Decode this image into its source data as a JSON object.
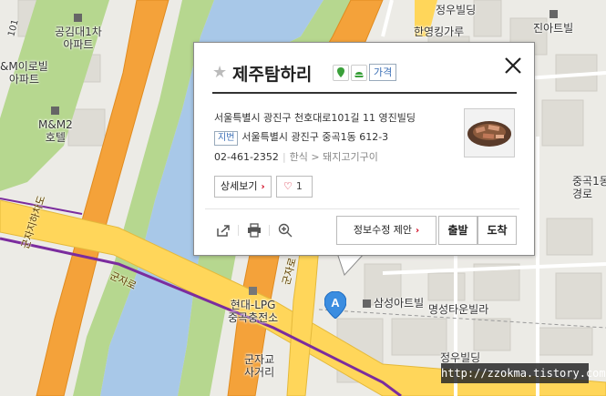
{
  "map": {
    "labels": {
      "gongpyeong": "공김대1차\n아파트",
      "mirae": "&M이로빌\n아파트",
      "mm2": "M&M2\n호텔",
      "jeongwoo_top": "정우빌딩",
      "jinatower": "진아트빌",
      "hanyeong": "한영킹가루",
      "junggok_right": "중곡1동\n경로",
      "samsung": "삼성아트빌",
      "myeongseong": "명성타운빌라",
      "hyundai": "현대-LPG\n중곡충전소",
      "gunja": "군자교\n사거리",
      "jeongwoo_bottom": "정우빌딩",
      "num101": "101"
    },
    "roads": {
      "gunjaro_1": "군자로",
      "gunjaro_2": "군자로",
      "jihadong": "군자지하차도",
      "gunjaro_bottom": "군자로"
    }
  },
  "popup": {
    "name": "제주탐하리",
    "price_badge": "가격",
    "address": "서울특별시 광진구 천호대로101길 11 영진빌딩",
    "jibun_tag": "지번",
    "jibun_address": "서울특별시 광진구 중곡1동 612-3",
    "phone": "02-461-2352",
    "category": "한식 > 돼지고기구이",
    "detail_button": "상세보기",
    "like_count": "1",
    "suggest_button": "정보수정 제안",
    "depart_button": "출발",
    "arrive_button": "도착"
  },
  "marker": {
    "letter": "A"
  },
  "watermark": "http://zzokma.tistory.com",
  "colors": {
    "expressway": "#f4a23a",
    "road_major": "#ffd65a",
    "river": "#a8c8e8",
    "park": "#b6d78f",
    "purple_line": "#7b2c9e",
    "marker_blue": "#3b8de0",
    "accent_red": "#d0021b"
  }
}
